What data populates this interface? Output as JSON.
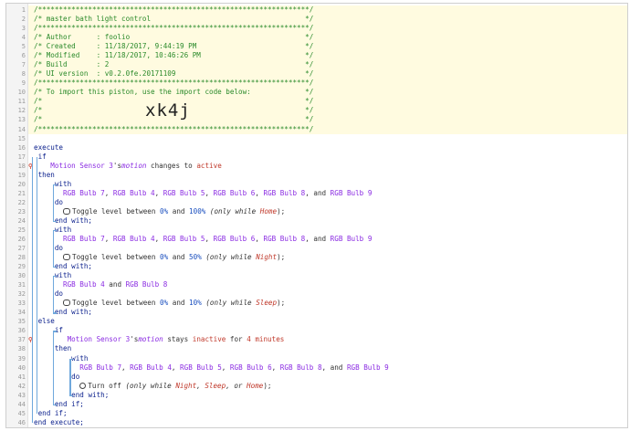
{
  "editor": {
    "import_code": "xk4j",
    "header_comment": [
      "/*****************************************************************/",
      "/* master bath light control                                     */",
      "/*****************************************************************/",
      "/* Author      : foolio                                          */",
      "/* Created     : 11/18/2017, 9:44:19 PM                          */",
      "/* Modified    : 11/18/2017, 10:46:26 PM                         */",
      "/* Build       : 2                                               */",
      "/* UI version  : v0.2.0fe.20171109                               */",
      "/*****************************************************************/",
      "/* To import this piston, use the import code below:             */",
      "/*                                                               */",
      "/*                                                               */",
      "/*                                                               */",
      "/*****************************************************************/"
    ],
    "piston": {
      "execute": "execute",
      "end_execute": "end execute;",
      "if": "if",
      "then": "then",
      "else": "else",
      "end_if": "end if;",
      "with": "with",
      "do": "do",
      "end_with": "end with;",
      "cond1": {
        "device": "Motion Sensor 3",
        "possessive": "'s",
        "attribute": "motion",
        "op": " changes to ",
        "value": "active"
      },
      "cond2": {
        "device": "Motion Sensor 3",
        "possessive": "'s",
        "attribute": "motion",
        "op": " stays ",
        "value": "inactive",
        "for": " for ",
        "duration": "4 minutes"
      },
      "with1_devices": [
        "RGB Bulb 7",
        "RGB Bulb 4",
        "RGB Bulb 5",
        "RGB Bulb 6",
        "RGB Bulb 8"
      ],
      "with1_last": "RGB Bulb 9",
      "with3_devices": [
        "RGB Bulb 4"
      ],
      "with3_last": "RGB Bulb 8",
      "sep": ", ",
      "and": ", and ",
      "and2": " and ",
      "toggle_prefix": "Toggle level between ",
      "toggle_from": "0%",
      "toggle_and": " and ",
      "toggle1_to": "100%",
      "toggle2_to": "50%",
      "toggle3_to": "10%",
      "only_while": " (only while ",
      "mode_home": "Home",
      "mode_night": "Night",
      "mode_sleep": "Sleep",
      "close": ");",
      "turn_off": "Turn off",
      "turn_off_cond_prefix": " (only while ",
      "comma": ", ",
      "or": ", or ",
      "turn_off_close": ");"
    },
    "line_numbers": [
      "1",
      "2",
      "3",
      "4",
      "5",
      "6",
      "7",
      "8",
      "9",
      "10",
      "11",
      "12",
      "13",
      "14",
      "15",
      "16",
      "17",
      "18",
      "19",
      "20",
      "21",
      "22",
      "23",
      "24",
      "25",
      "26",
      "27",
      "28",
      "29",
      "30",
      "31",
      "32",
      "33",
      "34",
      "35",
      "36",
      "37",
      "38",
      "39",
      "40",
      "41",
      "42",
      "43",
      "44",
      "45",
      "46"
    ],
    "breakpoint_lines": [
      "18",
      "37"
    ],
    "breakpoint_glyph": "⚲"
  }
}
